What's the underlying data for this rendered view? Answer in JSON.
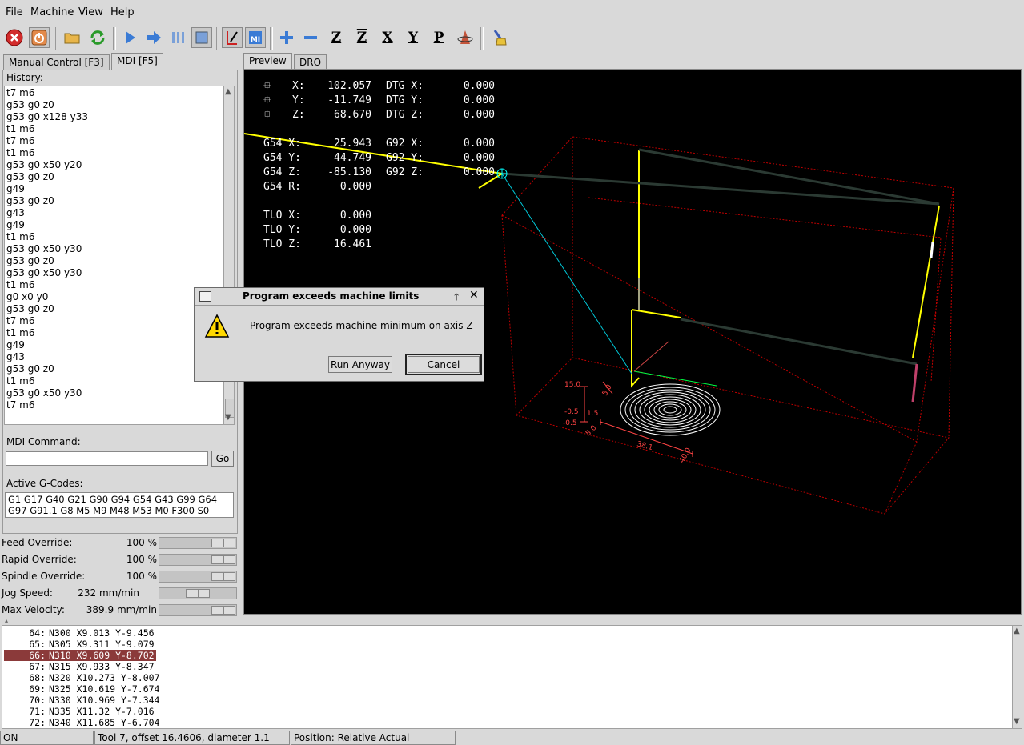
{
  "menu": [
    "File",
    "Machine",
    "View",
    "Help"
  ],
  "toolbar": {
    "icons": [
      "estop-icon",
      "power-icon",
      "open-file-icon",
      "reload-icon",
      "run-icon",
      "step-icon",
      "pause-icon",
      "stop-icon",
      "block-delete-icon",
      "optional-stop-icon",
      "zoom-in-icon",
      "zoom-out-icon",
      "view-z-icon",
      "view-z2-icon",
      "view-x-icon",
      "view-y-icon",
      "view-p-icon",
      "rotate-icon",
      "clear-plot-icon"
    ],
    "glyph_z": "Z",
    "glyph_z2": "Z",
    "glyph_x": "X",
    "glyph_y": "Y",
    "glyph_p": "P",
    "glyph_mi": "MI"
  },
  "left_tabs": [
    "Manual Control [F3]",
    "MDI [F5]"
  ],
  "right_tabs": [
    "Preview",
    "DRO"
  ],
  "mdi": {
    "history_label": "History:",
    "history": [
      "t7 m6",
      "g53 g0 z0",
      "g53 g0 x128 y33",
      "t1 m6",
      "t7 m6",
      "t1 m6",
      "g53 g0 x50 y20",
      "g53 g0 z0",
      "g49",
      "g53 g0 z0",
      "g43",
      "g49",
      "t1 m6",
      "g53 g0 x50 y30",
      "g53 g0 z0",
      "g53 g0 x50 y30",
      "t1 m6",
      "g0 x0 y0",
      "g53 g0 z0",
      "t7 m6",
      "t1 m6",
      "g49",
      "g43",
      "g53 g0 z0",
      "t1 m6",
      "g53 g0 x50 y30",
      "t7 m6"
    ],
    "command_label": "MDI Command:",
    "command_value": "",
    "go_label": "Go",
    "active_label": "Active G-Codes:",
    "active_line1": "G1 G17 G40 G21 G90 G94 G54 G43 G99 G64",
    "active_line2": "G97 G91.1 G8 M5 M9 M48 M53 M0 F300 S0"
  },
  "overrides": [
    {
      "label": "Feed Override:",
      "value": "100 %",
      "level": 1.0
    },
    {
      "label": "Rapid Override:",
      "value": "100 %",
      "level": 1.0
    },
    {
      "label": "Spindle Override:",
      "value": "100 %",
      "level": 1.0
    },
    {
      "label": "Jog Speed:",
      "value": "232 mm/min",
      "level": 0.5
    },
    {
      "label": "Max Velocity:",
      "value": "389.9 mm/min",
      "level": 1.0
    }
  ],
  "dro": {
    "abs": [
      {
        "axis": "X:",
        "value": "102.057",
        "dtg": "DTG X:",
        "dtg_value": "0.000"
      },
      {
        "axis": "Y:",
        "value": "-11.749",
        "dtg": "DTG Y:",
        "dtg_value": "0.000"
      },
      {
        "axis": "Z:",
        "value": "68.670",
        "dtg": "DTG Z:",
        "dtg_value": "0.000"
      }
    ],
    "g54": [
      {
        "axis": "G54 X:",
        "value": "25.943",
        "g92": "G92 X:",
        "g92_value": "0.000"
      },
      {
        "axis": "G54 Y:",
        "value": "44.749",
        "g92": "G92 Y:",
        "g92_value": "0.000"
      },
      {
        "axis": "G54 Z:",
        "value": "-85.130",
        "g92": "G92 Z:",
        "g92_value": "0.000"
      },
      {
        "axis": "G54 R:",
        "value": "0.000",
        "g92": "",
        "g92_value": ""
      }
    ],
    "tlo": [
      {
        "axis": "TLO X:",
        "value": "0.000"
      },
      {
        "axis": "TLO Y:",
        "value": "0.000"
      },
      {
        "axis": "TLO Z:",
        "value": "16.461"
      }
    ]
  },
  "preview_labels": {
    "dim1": "15.0",
    "dim2": "1.5",
    "dim3": "-0.5",
    "dim4": "-0.5",
    "dim5": "5.0",
    "dim6": "38.1",
    "dim7": "40.0",
    "dim8": "5.0"
  },
  "dialog": {
    "title": "Program exceeds machine limits",
    "message": "Program exceeds machine minimum on axis Z",
    "run_anyway": "Run Anyway",
    "cancel": "Cancel"
  },
  "listing": [
    {
      "num": "64:",
      "code": "N300 X9.013 Y-9.456",
      "selected": false
    },
    {
      "num": "65:",
      "code": "N305 X9.311 Y-9.079",
      "selected": false
    },
    {
      "num": "66:",
      "code": "N310 X9.609 Y-8.702",
      "selected": true
    },
    {
      "num": "67:",
      "code": "N315 X9.933 Y-8.347",
      "selected": false
    },
    {
      "num": "68:",
      "code": "N320 X10.273 Y-8.007",
      "selected": false
    },
    {
      "num": "69:",
      "code": "N325 X10.619 Y-7.674",
      "selected": false
    },
    {
      "num": "70:",
      "code": "N330 X10.969 Y-7.344",
      "selected": false
    },
    {
      "num": "71:",
      "code": "N335 X11.32 Y-7.016",
      "selected": false
    },
    {
      "num": "72:",
      "code": "N340 X11.685 Y-6.704",
      "selected": false
    }
  ],
  "status": {
    "state": "ON",
    "tool": "Tool 7, offset 16.4606, diameter 1.1",
    "position": "Position: Relative Actual"
  },
  "colors": {
    "estop": "#d22b2b",
    "toolpath": "#ffff00",
    "rapid": "#00ffff",
    "limits": "#ff0000",
    "selected_line": "#8b3a3a"
  }
}
